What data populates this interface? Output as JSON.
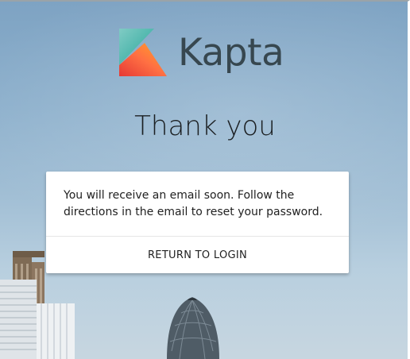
{
  "brand": {
    "name": "Kapta",
    "logo_icon": "kapta-logo-icon",
    "text_color": "#37474f",
    "mark_colors": [
      "#4db6ac",
      "#26a69a",
      "#ff7043",
      "#e53935"
    ]
  },
  "page": {
    "heading": "Thank you"
  },
  "card": {
    "message": "You will receive an email soon. Follow the directions in the email to reset your password.",
    "action_label": "RETURN TO LOGIN"
  },
  "background": {
    "description_colors": [
      "#7ea3c3",
      "#c7d6e0"
    ]
  }
}
